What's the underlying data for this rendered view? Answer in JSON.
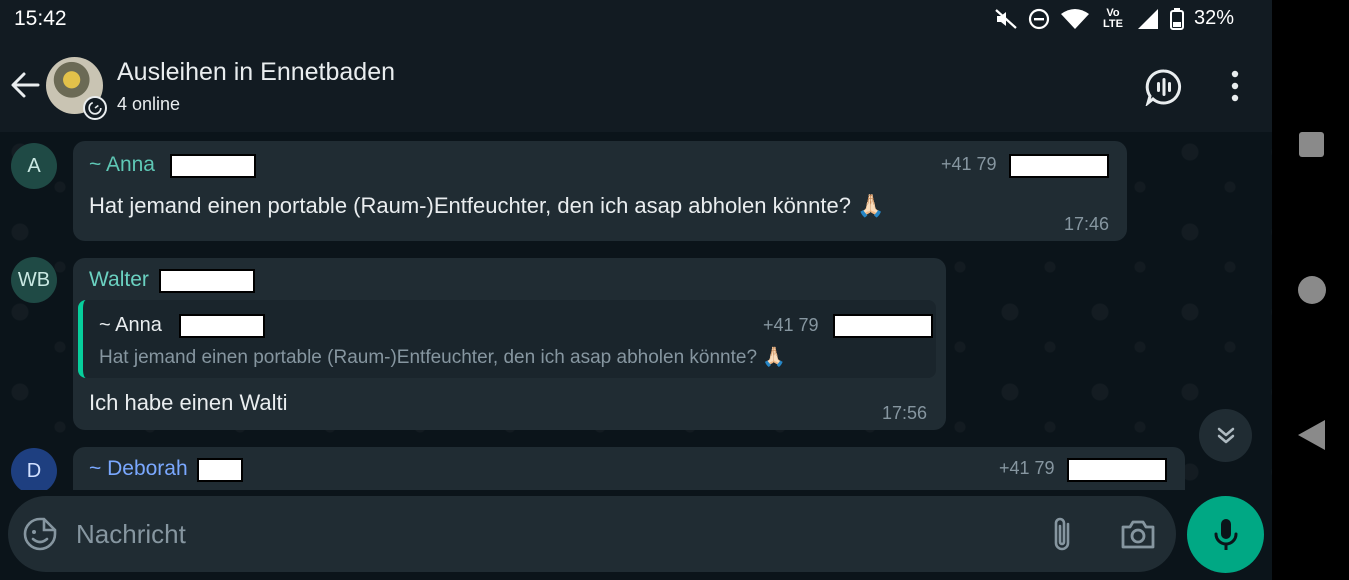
{
  "status_bar": {
    "time": "15:42",
    "network_label": "Vo LTE",
    "battery": "32%",
    "icons": [
      "mute-icon",
      "dnd-icon",
      "wifi-icon",
      "volte-icon",
      "signal-icon",
      "battery-icon"
    ]
  },
  "header": {
    "title": "Ausleihen in Ennetbaden",
    "subtitle": "4 online",
    "icons": [
      "back-arrow-icon",
      "group-avatar",
      "disappearing-timer-icon",
      "voice-chat-icon",
      "more-vert-icon"
    ]
  },
  "messages": [
    {
      "avatar_initial": "A",
      "sender": "~ Anna",
      "phone": "+41 79",
      "text": "Hat jemand einen portable (Raum-)Entfeuchter, den ich asap abholen könnte? 🙏🏻",
      "time": "17:46"
    },
    {
      "avatar_initial": "WB",
      "sender": "Walter",
      "quote": {
        "sender": "~ Anna",
        "phone": "+41 79",
        "text": "Hat jemand einen portable (Raum-)Entfeuchter, den ich asap abholen könnte? 🙏🏻"
      },
      "text": "Ich habe einen Walti",
      "time": "17:56"
    },
    {
      "avatar_initial": "D",
      "sender": "~ Deborah",
      "phone": "+41 79"
    }
  ],
  "input": {
    "placeholder": "Nachricht"
  },
  "colors": {
    "background": "#0b141a",
    "header": "#121b22",
    "bubble": "#202c33",
    "accent_green": "#00a884",
    "name_teal": "#53bdeb",
    "name_anna": "#5ec7b5",
    "name_walter": "#6bd1c1",
    "name_deborah": "#7aa8ff"
  }
}
